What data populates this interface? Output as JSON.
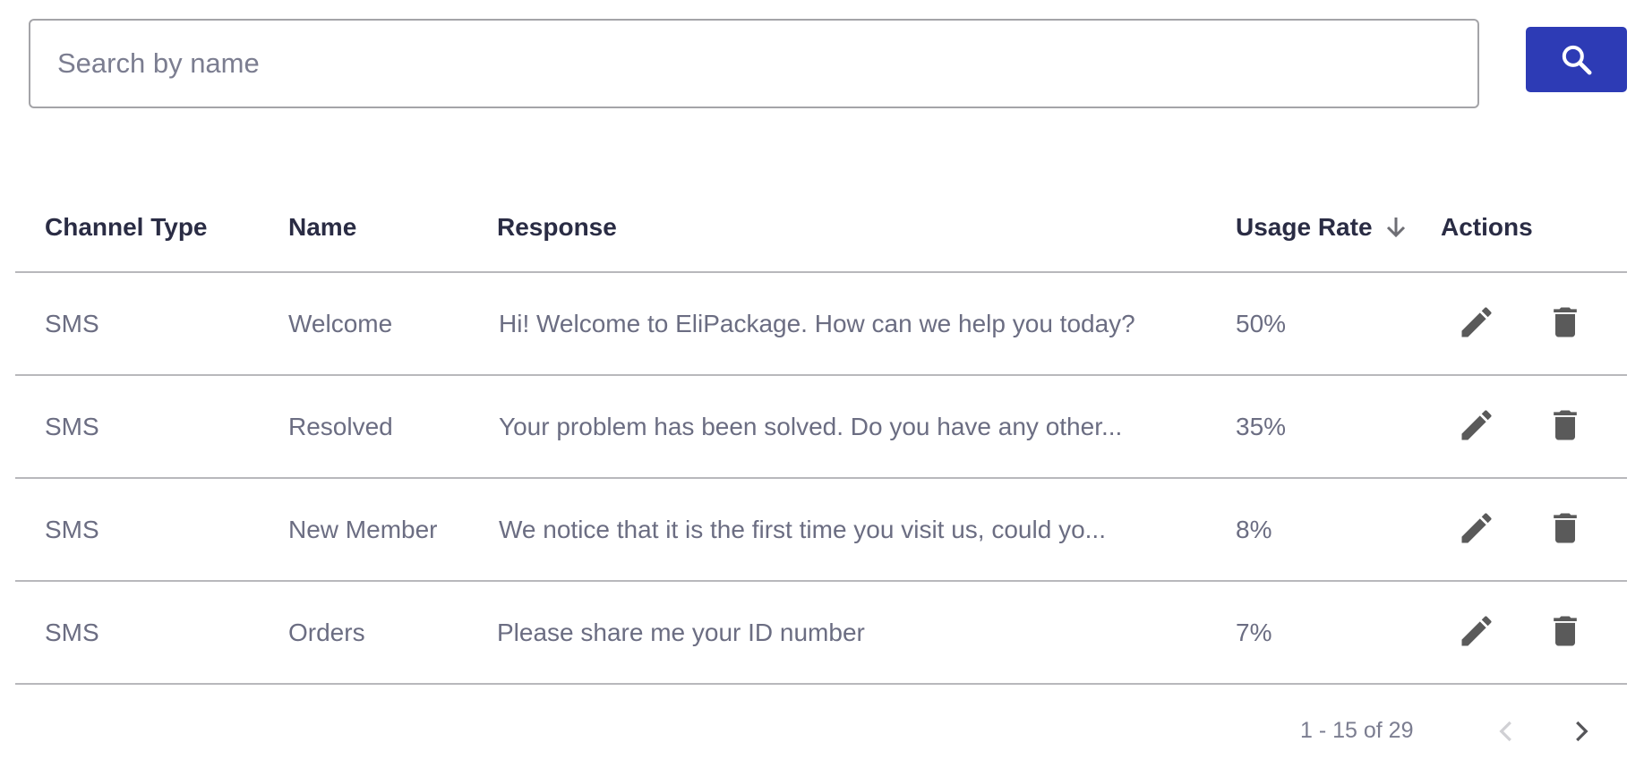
{
  "search": {
    "placeholder": "Search by name",
    "value": "",
    "button_icon": "search-icon",
    "button_color": "#2d3bb5"
  },
  "table": {
    "columns": {
      "channel_type": "Channel Type",
      "name": "Name",
      "response": "Response",
      "usage_rate": "Usage Rate",
      "actions": "Actions"
    },
    "sort": {
      "column": "Usage Rate",
      "direction": "descending",
      "icon": "arrow-down-icon"
    },
    "rows": [
      {
        "channel_type": "SMS",
        "name": "Welcome",
        "response": "Hi! Welcome to EliPackage. How can we help you today?",
        "usage_rate": "50%"
      },
      {
        "channel_type": "SMS",
        "name": "Resolved",
        "response": "Your problem has been solved. Do you have any other...",
        "usage_rate": "35%"
      },
      {
        "channel_type": "SMS",
        "name": "New Member",
        "response": "We notice that it is the first time you visit us, could yo...",
        "usage_rate": "8%"
      },
      {
        "channel_type": "SMS",
        "name": "Orders",
        "response": "Please share me your ID number",
        "usage_rate": "7%"
      }
    ],
    "row_actions": [
      "edit-icon",
      "delete-icon"
    ]
  },
  "pagination": {
    "range_text": "1 - 15 of 29",
    "prev_enabled": false,
    "next_enabled": true
  },
  "colors": {
    "accent": "#2d3bb5",
    "header_text": "#2a2c44",
    "body_text": "#6b6d82",
    "icon": "#5a5a5a",
    "divider": "#b8b8bc"
  }
}
